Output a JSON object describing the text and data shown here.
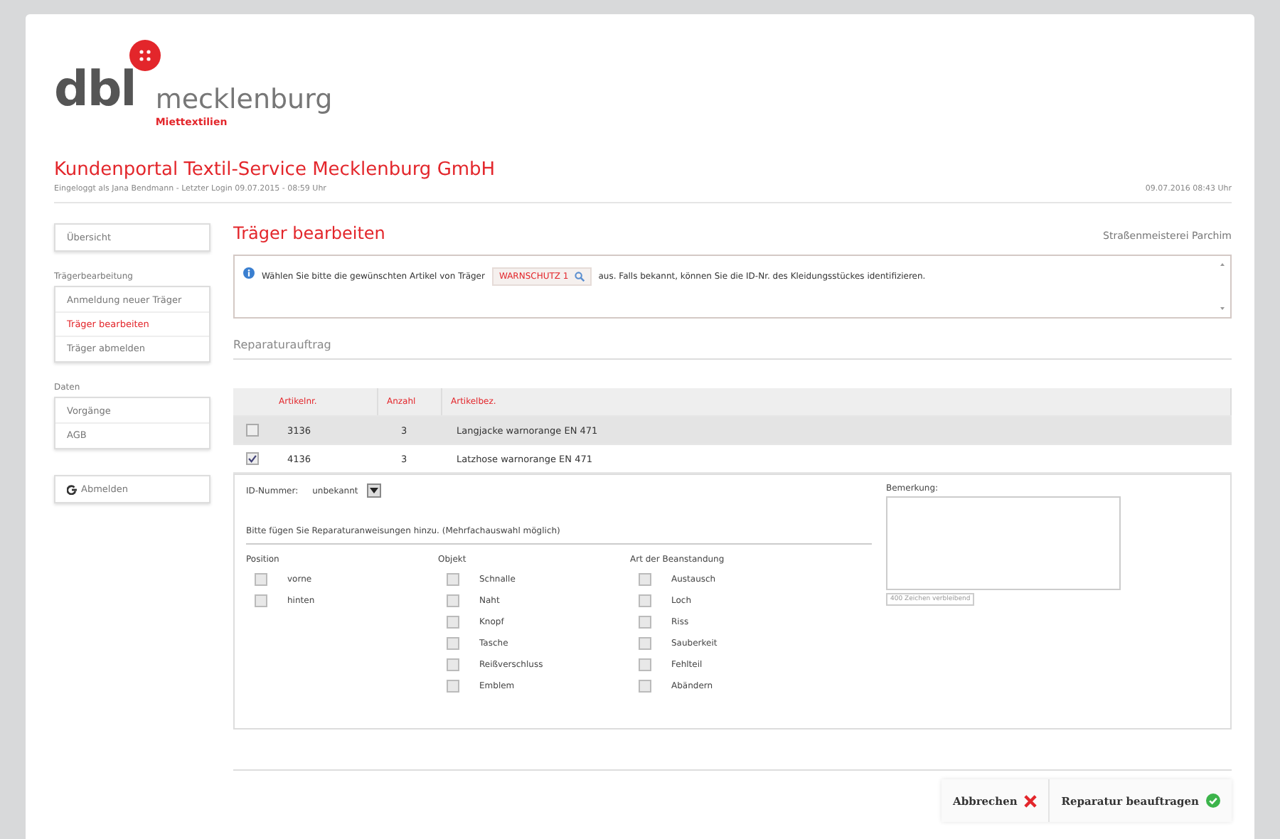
{
  "logo": {
    "brand": "dbl",
    "region": "mecklenburg",
    "tagline": "Miettextilien"
  },
  "header": {
    "title": "Kundenportal Textil-Service Mecklenburg GmbH",
    "login_info": "Eingeloggt als Jana Bendmann - Letzter Login 09.07.2015 - 08:59 Uhr",
    "datetime": "09.07.2016 08:43 Uhr"
  },
  "sidebar": {
    "groups": [
      {
        "items": [
          {
            "label": "Übersicht",
            "selected": false
          }
        ]
      },
      {
        "title": "Trägerbearbeitung",
        "items": [
          {
            "label": "Anmeldung neuer Träger",
            "selected": false
          },
          {
            "label": "Träger bearbeiten",
            "selected": true
          },
          {
            "label": "Träger abmelden",
            "selected": false
          }
        ]
      },
      {
        "title": "Daten",
        "items": [
          {
            "label": "Vorgänge",
            "selected": false
          },
          {
            "label": "AGB",
            "selected": false
          }
        ]
      },
      {
        "items": [
          {
            "label": "Abmelden",
            "selected": false,
            "kind": "logout"
          }
        ]
      }
    ]
  },
  "page": {
    "title": "Träger bearbeiten",
    "customer": "Straßenmeisterei Parchim",
    "info": {
      "before": "Wählen Sie bitte die gewünschten Artikel von Träger",
      "tag": "WARNSCHUTZ 1",
      "after": "aus. Falls bekannt, können Sie die ID-Nr. des Kleidungsstückes identifizieren."
    },
    "section": "Reparaturauftrag",
    "table": {
      "columns": [
        "Artikelnr.",
        "Anzahl",
        "Artikelbez."
      ],
      "rows": [
        {
          "checked": false,
          "selected": true,
          "cells": [
            "3136",
            "3",
            "Langjacke warnorange EN 471"
          ]
        },
        {
          "checked": true,
          "selected": false,
          "cells": [
            "4136",
            "3",
            "Latzhose warnorange EN 471"
          ]
        }
      ]
    },
    "detail": {
      "id_label": "ID-Nummer:",
      "id_value": "unbekannt",
      "hint": "Bitte fügen Sie Reparaturanweisungen hinzu. (Mehrfachauswahl möglich)",
      "groups": [
        {
          "title": "Position",
          "options": [
            {
              "label": "vorne",
              "checked": false
            },
            {
              "label": "hinten",
              "checked": false
            }
          ]
        },
        {
          "title": "Objekt",
          "options": [
            {
              "label": "Schnalle",
              "checked": false
            },
            {
              "label": "Naht",
              "checked": false
            },
            {
              "label": "Knopf",
              "checked": false
            },
            {
              "label": "Tasche",
              "checked": false
            },
            {
              "label": "Reißverschluss",
              "checked": false
            },
            {
              "label": "Emblem",
              "checked": false
            }
          ]
        },
        {
          "title": "Art der Beanstandung",
          "options": [
            {
              "label": "Austausch",
              "checked": false
            },
            {
              "label": "Loch",
              "checked": false
            },
            {
              "label": "Riss",
              "checked": false
            },
            {
              "label": "Sauberkeit",
              "checked": false
            },
            {
              "label": "Fehlteil",
              "checked": false
            },
            {
              "label": "Abändern",
              "checked": false
            }
          ]
        }
      ],
      "remark_label": "Bemerkung:",
      "remark_counter": "400 Zeichen verbleibend"
    }
  },
  "buttons": [
    {
      "label": "Abbrechen",
      "kind": "cancel"
    },
    {
      "label": "Reparatur beauftragen",
      "kind": "confirm"
    }
  ]
}
